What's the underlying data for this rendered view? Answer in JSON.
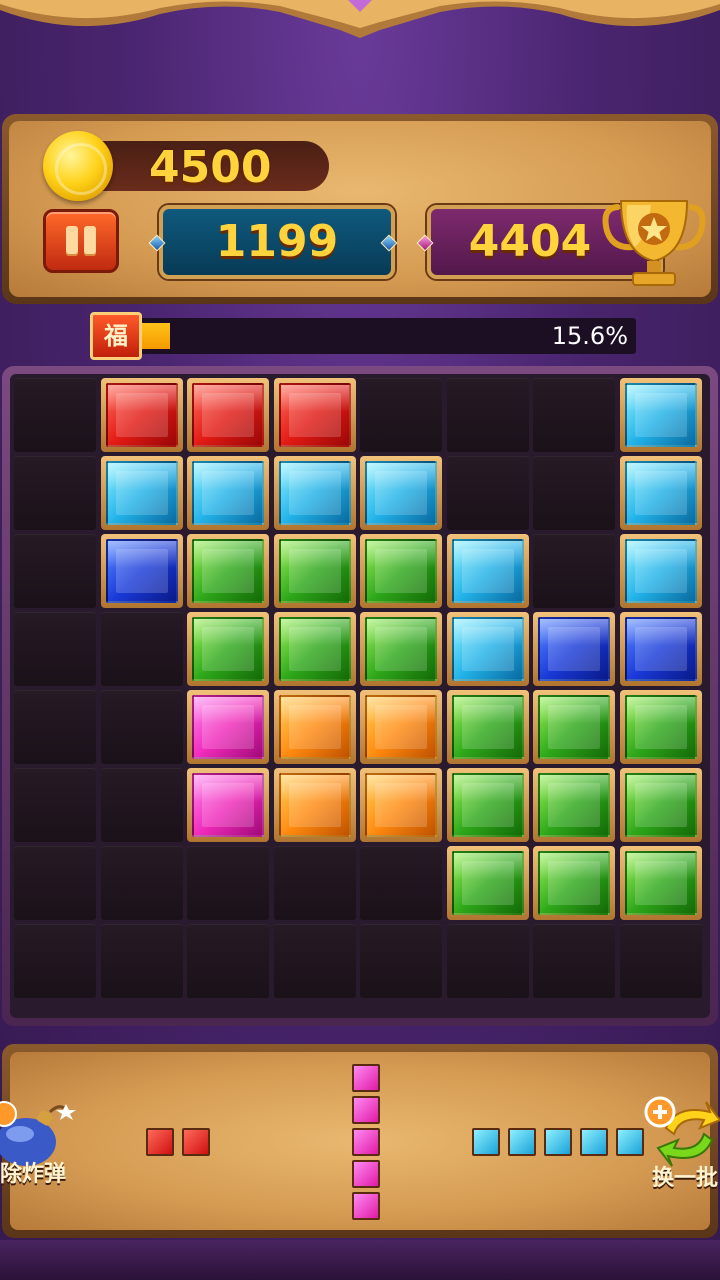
{
  "coins": "4500",
  "score": "1199",
  "best_score": "4404",
  "progress": {
    "badge": "福",
    "label": "15.6%",
    "fraction": 0.156
  },
  "board": {
    "rows": [
      [
        "",
        "red",
        "red",
        "red",
        "",
        "",
        "",
        "cyan"
      ],
      [
        "",
        "cyan",
        "cyan",
        "cyan",
        "cyan",
        "",
        "",
        "cyan"
      ],
      [
        "",
        "blue",
        "green",
        "green",
        "green",
        "cyan",
        "",
        "cyan"
      ],
      [
        "",
        "",
        "green",
        "green",
        "green",
        "cyan",
        "blue",
        "blue"
      ],
      [
        "",
        "",
        "pink",
        "orange",
        "orange",
        "green",
        "green",
        "green"
      ],
      [
        "",
        "",
        "pink",
        "orange",
        "orange",
        "green",
        "green",
        "green"
      ],
      [
        "",
        "",
        "",
        "",
        "",
        "green",
        "green",
        "green"
      ],
      [
        "",
        "",
        "",
        "",
        "",
        "",
        "",
        ""
      ]
    ]
  },
  "tray": {
    "pieces": [
      {
        "color": "red",
        "orientation": "horizontal",
        "length": 2
      },
      {
        "color": "pink",
        "orientation": "vertical",
        "length": 5
      },
      {
        "color": "cyan",
        "orientation": "horizontal",
        "length": 5
      }
    ]
  },
  "powerups": {
    "bomb_label": "除炸弹",
    "swap_label": "换一批"
  },
  "icons": {
    "coin": "coin-icon",
    "pause": "pause-icon",
    "trophy": "trophy-icon",
    "bomb": "bomb-icon",
    "swap": "swap-icon"
  }
}
